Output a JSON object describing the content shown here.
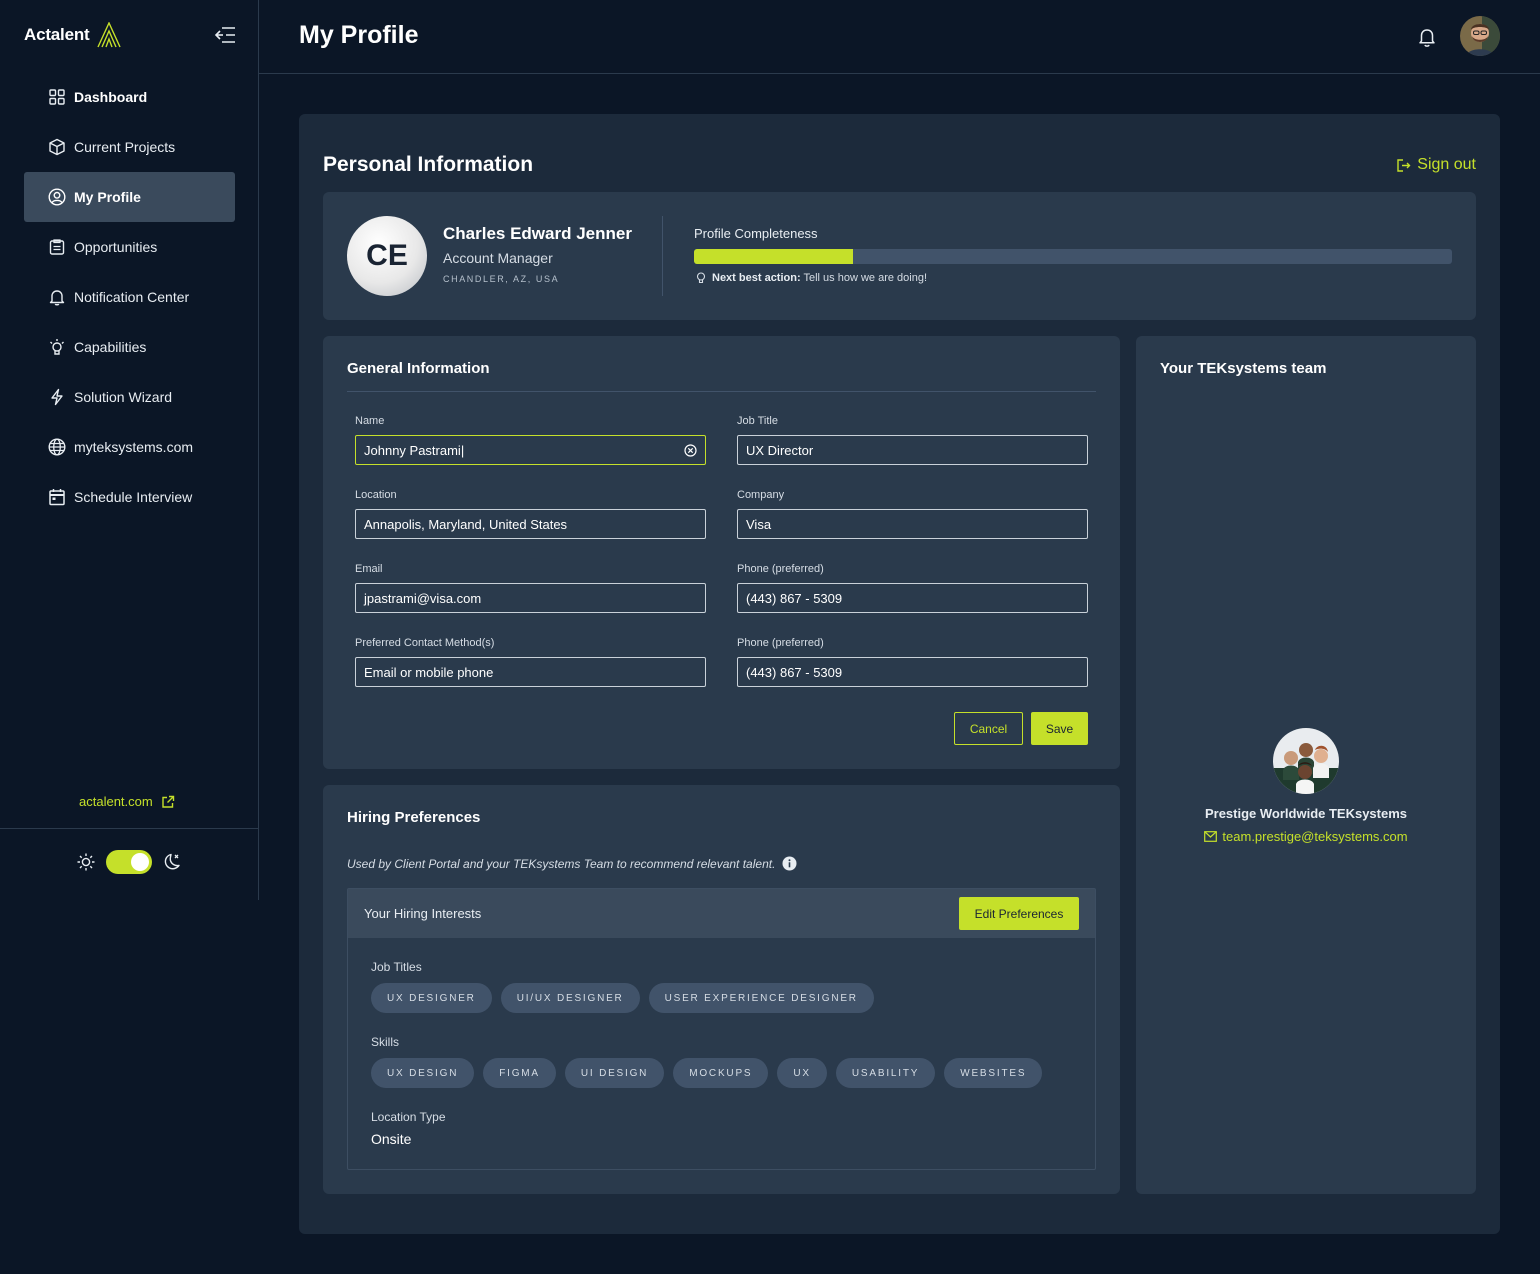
{
  "brand": {
    "name": "Actalent",
    "accent": "#c5e02a"
  },
  "sidebar": {
    "items": [
      {
        "label": "Dashboard",
        "icon": "grid-icon"
      },
      {
        "label": "Current Projects",
        "icon": "cube-icon"
      },
      {
        "label": "My Profile",
        "icon": "user-circle-icon",
        "active": true
      },
      {
        "label": "Opportunities",
        "icon": "clipboard-icon"
      },
      {
        "label": "Notification Center",
        "icon": "bell-icon"
      },
      {
        "label": "Capabilities",
        "icon": "lightbulb-icon"
      },
      {
        "label": "Solution Wizard",
        "icon": "lightning-icon"
      },
      {
        "label": "myteksystems.com",
        "icon": "globe-icon"
      },
      {
        "label": "Schedule Interview",
        "icon": "calendar-icon"
      }
    ],
    "external_link": "actalent.com"
  },
  "header": {
    "title": "My Profile"
  },
  "personal": {
    "title": "Personal Information",
    "sign_out": "Sign out",
    "initials": "CE",
    "name": "Charles Edward Jenner",
    "role": "Account Manager",
    "location": "CHANDLER, AZ, USA",
    "completeness_label": "Profile Completeness",
    "completeness_percent": 21,
    "next_action_label": "Next best action:",
    "next_action_text": "Tell us how we are doing!"
  },
  "general": {
    "title": "General Information",
    "fields": {
      "name": {
        "label": "Name",
        "value": "Johnny Pastrami|"
      },
      "job_title": {
        "label": "Job Title",
        "value": "UX Director"
      },
      "location": {
        "label": "Location",
        "value": "Annapolis, Maryland, United States"
      },
      "company": {
        "label": "Company",
        "value": "Visa"
      },
      "email": {
        "label": "Email",
        "value": "jpastrami@visa.com"
      },
      "phone1": {
        "label": "Phone (preferred)",
        "value": "(443) 867 - 5309"
      },
      "contact": {
        "label": "Preferred Contact Method(s)",
        "value": "Email or mobile phone"
      },
      "phone2": {
        "label": "Phone (preferred)",
        "value": "(443) 867 - 5309"
      }
    },
    "cancel": "Cancel",
    "save": "Save"
  },
  "hiring": {
    "title": "Hiring Preferences",
    "description": "Used by Client Portal and your TEKsystems Team to recommend relevant talent.",
    "interests_title": "Your Hiring Interests",
    "edit_button": "Edit Preferences",
    "job_titles_label": "Job Titles",
    "job_titles": [
      "UX DESIGNER",
      "UI/UX DESIGNER",
      "USER EXPERIENCE DESIGNER"
    ],
    "skills_label": "Skills",
    "skills": [
      "UX DESIGN",
      "FIGMA",
      "UI DESIGN",
      "MOCKUPS",
      "UX",
      "USABILITY",
      "WEBSITES"
    ],
    "location_type_label": "Location Type",
    "location_type": "Onsite"
  },
  "team": {
    "title": "Your TEKsystems team",
    "name": "Prestige Worldwide TEKsystems",
    "email": "team.prestige@teksystems.com"
  }
}
